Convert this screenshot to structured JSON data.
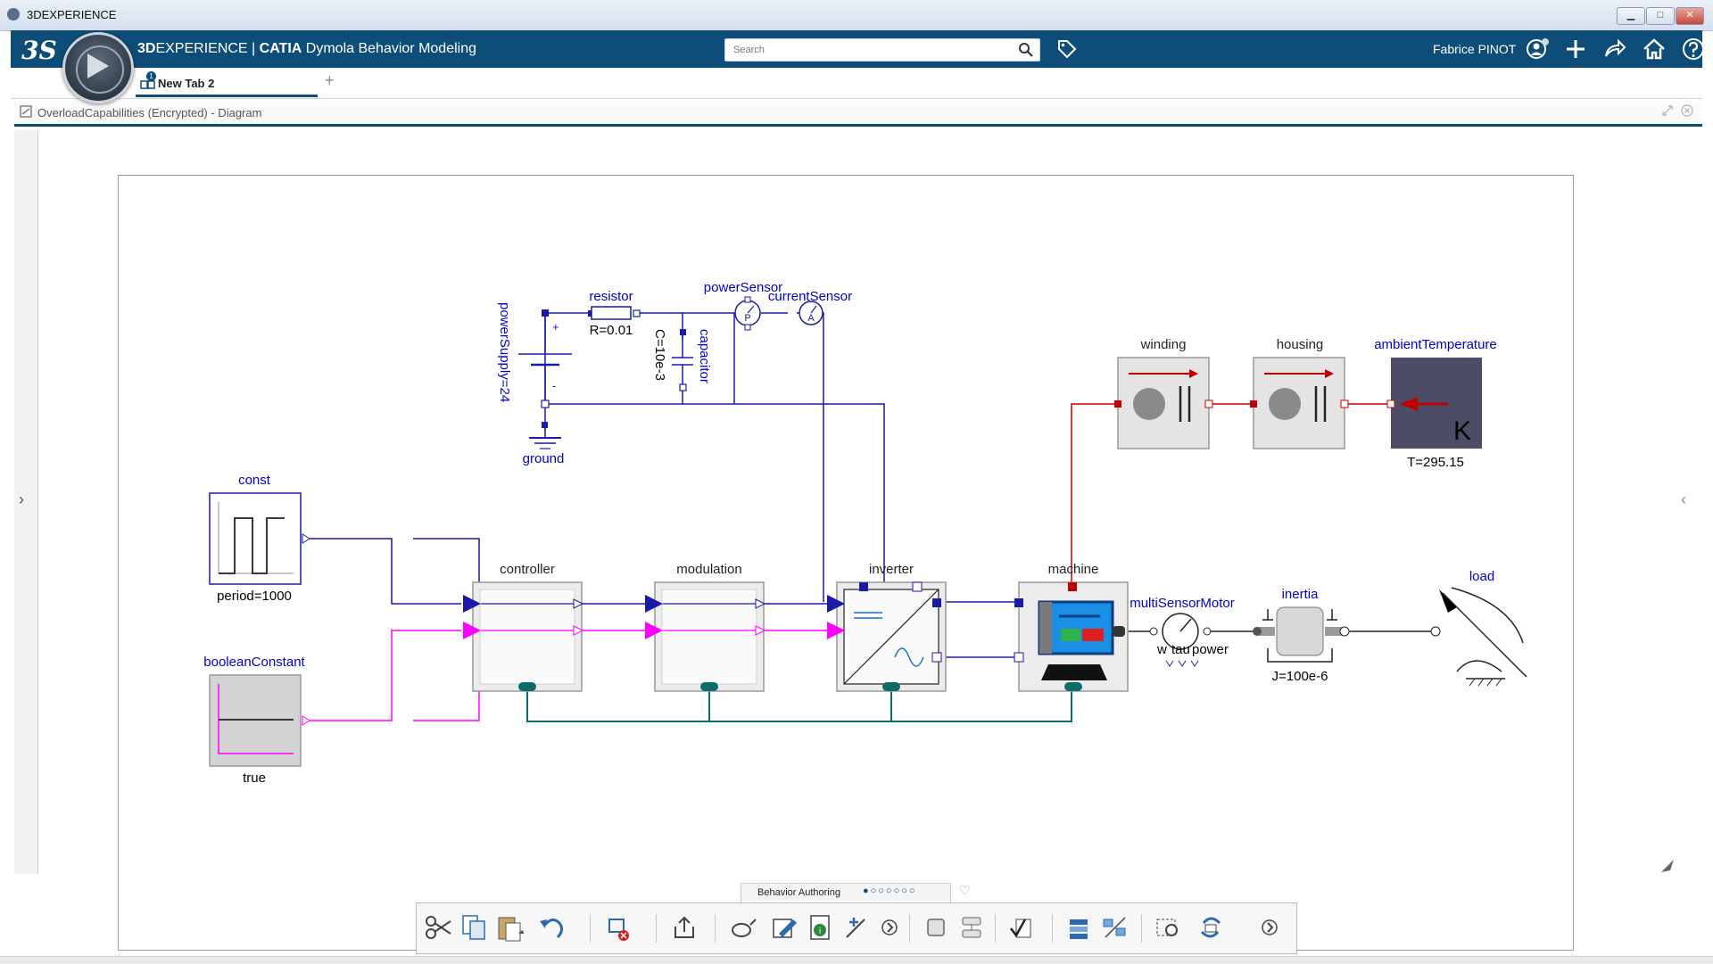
{
  "window": {
    "title": "3DEXPERIENCE",
    "min_label": "▁",
    "max_label": "□",
    "close_label": "✕"
  },
  "topbar": {
    "logo_text": "3S",
    "brand_prefix": "3D",
    "brand_experience": "EXPERIENCE | ",
    "brand_catia": "CATIA",
    "brand_app": " Dymola Behavior Modeling",
    "search_placeholder": "Search",
    "user_name": "Fabrice PINOT",
    "accent_color": "#0e4d78"
  },
  "tabs": {
    "items": [
      {
        "label": "New Tab 2",
        "badge": "1"
      }
    ],
    "add_label": "+"
  },
  "document": {
    "title": "OverloadCapabilities (Encrypted) - Diagram"
  },
  "side": {
    "left_chevron": "›",
    "right_chevron": "‹"
  },
  "diagram": {
    "labels": {
      "powerSupply": "powerSupply=24",
      "resistor": "resistor",
      "R": "R=0.01",
      "C": "C=10e-3",
      "capacitor": "capacitor",
      "powerSensor": "powerSensor",
      "currentSensor": "currentSensor",
      "ground": "ground",
      "winding": "winding",
      "housing": "housing",
      "ambientTemperature": "ambientTemperature",
      "T": "T=295.15",
      "K": "K",
      "const": "const",
      "period": "period=1000",
      "booleanConstant": "booleanConstant",
      "true_label": "true",
      "controller": "controller",
      "modulation": "modulation",
      "inverter": "inverter",
      "machine": "machine",
      "multiSensorMotor": "multiSensorMotor",
      "w": "w",
      "tau": "tau",
      "power": "power",
      "inertia": "inertia",
      "J": "J=100e-6",
      "load": "load",
      "plus": "+",
      "minus": "-",
      "P": "P",
      "A": "A"
    },
    "colors": {
      "electric": "#1a1aa8",
      "thermal": "#c00000",
      "boolean": "#ff00ff",
      "bus": "#0c6b6b",
      "label_blue": "#0000cc"
    }
  },
  "pager": {
    "label": "Behavior Authoring",
    "dots": "●○○○○○○",
    "more": "♡"
  },
  "toolbar": {
    "icons": [
      "cut-icon",
      "copy-icon",
      "paste-icon",
      "undo-icon",
      "replace-icon",
      "export-icon",
      "connect-icon",
      "edit-icon",
      "info-icon",
      "add-connector-icon",
      "more-icon",
      "rectangle-icon",
      "component-icon",
      "check-icon",
      "layer-icon",
      "align-icon",
      "settings-icon",
      "refresh-icon",
      "next-icon"
    ]
  }
}
